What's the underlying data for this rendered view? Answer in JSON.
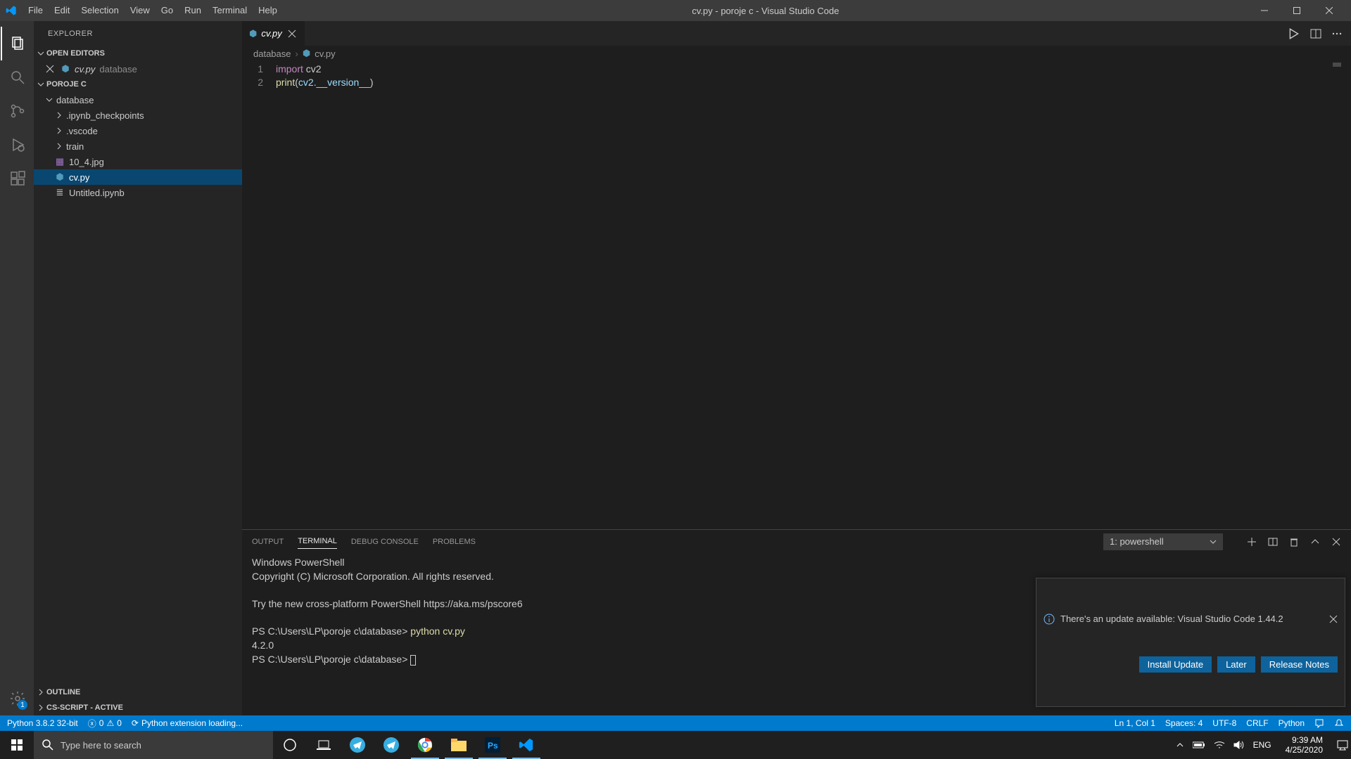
{
  "titlebar": {
    "menus": [
      "File",
      "Edit",
      "Selection",
      "View",
      "Go",
      "Run",
      "Terminal",
      "Help"
    ],
    "title": "cv.py - poroje c - Visual Studio Code"
  },
  "sidebar": {
    "header": "Explorer",
    "openEditors": {
      "label": "Open Editors"
    },
    "openEditorItems": [
      {
        "name": "cv.py",
        "dir": "database"
      }
    ],
    "project": {
      "label": "poroje c"
    },
    "tree": [
      {
        "kind": "folder",
        "name": "database",
        "depth": 0,
        "open": true
      },
      {
        "kind": "folder",
        "name": ".ipynb_checkpoints",
        "depth": 1,
        "open": false
      },
      {
        "kind": "folder",
        "name": ".vscode",
        "depth": 1,
        "open": false
      },
      {
        "kind": "folder",
        "name": "train",
        "depth": 1,
        "open": false
      },
      {
        "kind": "file",
        "name": "10_4.jpg",
        "depth": 1,
        "icon": "image"
      },
      {
        "kind": "file",
        "name": "cv.py",
        "depth": 1,
        "icon": "python",
        "selected": true
      },
      {
        "kind": "file",
        "name": "Untitled.ipynb",
        "depth": 1,
        "icon": "notebook"
      }
    ],
    "outline": {
      "label": "Outline"
    },
    "csscript": {
      "label": "CS-Script - Active"
    }
  },
  "editor": {
    "tab": {
      "name": "cv.py"
    },
    "breadcrumb": {
      "root": "database",
      "file": "cv.py"
    },
    "lines": [
      "1",
      "2"
    ],
    "code": {
      "l1": {
        "kw": "import",
        "rest": " cv2"
      },
      "l2": {
        "fn": "print",
        "open": "(",
        "mod": "cv2.",
        "dunder": "__version__",
        "close": ")"
      }
    }
  },
  "panel": {
    "tabs": [
      "Output",
      "Terminal",
      "Debug Console",
      "Problems"
    ],
    "activeTab": 1,
    "selector": "1: powershell",
    "terminal": {
      "l1": "Windows PowerShell",
      "l2": "Copyright (C) Microsoft Corporation. All rights reserved.",
      "l3": "Try the new cross-platform PowerShell https://aka.ms/pscore6",
      "prompt1": "PS C:\\Users\\LP\\poroje c\\database> ",
      "cmd": "python cv.py",
      "out": "4.2.0",
      "prompt2": "PS C:\\Users\\LP\\poroje c\\database> "
    }
  },
  "notification": {
    "message": "There's an update available: Visual Studio Code 1.44.2",
    "buttons": {
      "install": "Install Update",
      "later": "Later",
      "notes": "Release Notes"
    }
  },
  "status": {
    "python": "Python 3.8.2 32-bit",
    "errors": "0",
    "warnings": "0",
    "loading": "Python extension loading...",
    "ln": "Ln 1, Col 1",
    "spaces": "Spaces: 4",
    "enc": "UTF-8",
    "eol": "CRLF",
    "lang": "Python"
  },
  "taskbar": {
    "search": "Type here to search",
    "time": "9:39 AM",
    "date": "4/25/2020",
    "lang": "ENG"
  }
}
